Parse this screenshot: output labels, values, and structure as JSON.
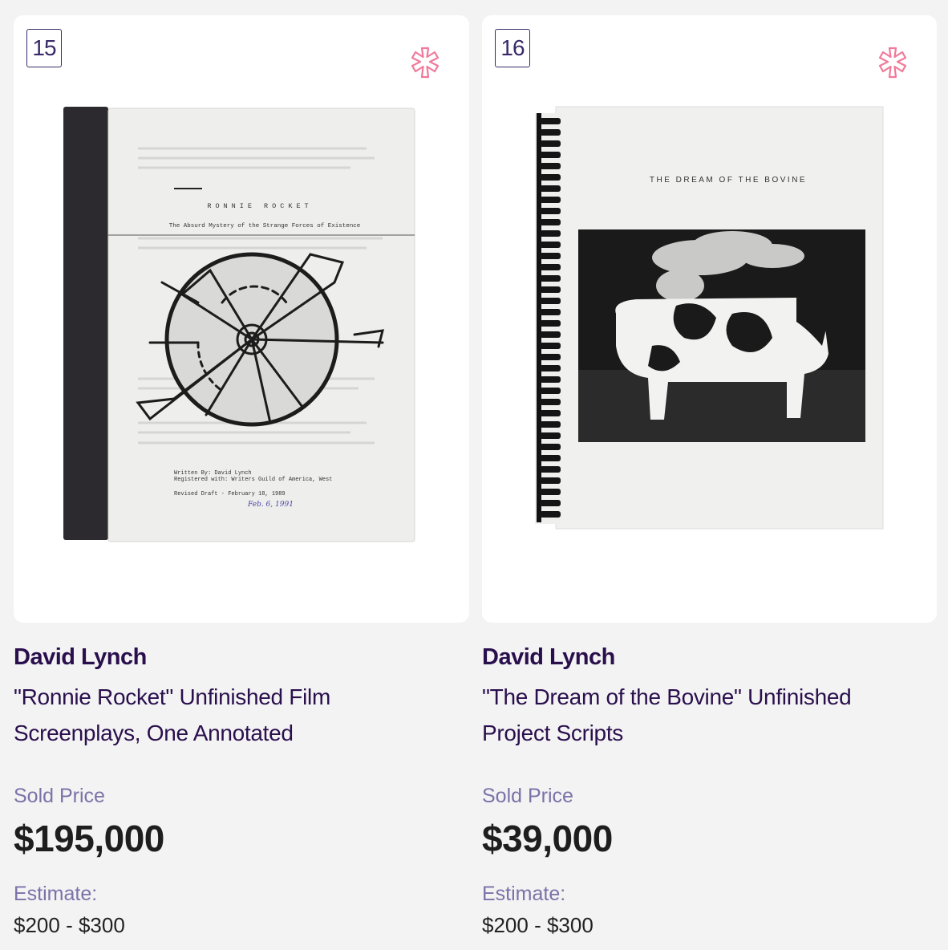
{
  "lots": [
    {
      "number": "15",
      "artist": "David Lynch",
      "title": "\"Ronnie Rocket\" Unfinished Film Screenplays, One Annotated",
      "sold_label": "Sold Price",
      "price": "$195,000",
      "estimate_label": "Estimate:",
      "estimate": "$200 - $300",
      "image": {
        "heading": "RONNIE ROCKET",
        "subtitle": "The Absurd Mystery of the Strange Forces of Existence",
        "written_by": "Written By:    David Lynch",
        "registered": "Registered with:  Writers Guild of America, West",
        "revised": "Revised Draft - February 18, 1989",
        "annotation": "Feb. 6, 1991"
      }
    },
    {
      "number": "16",
      "artist": "David Lynch",
      "title": "\"The Dream of the Bovine\" Unfinished Project Scripts",
      "sold_label": "Sold Price",
      "price": "$39,000",
      "estimate_label": "Estimate:",
      "estimate": "$200 - $300",
      "image": {
        "heading": "THE DREAM OF THE BOVINE"
      }
    }
  ],
  "icons": {
    "favorite": "asterisk-outline-icon",
    "accent": "#f07a9a"
  }
}
